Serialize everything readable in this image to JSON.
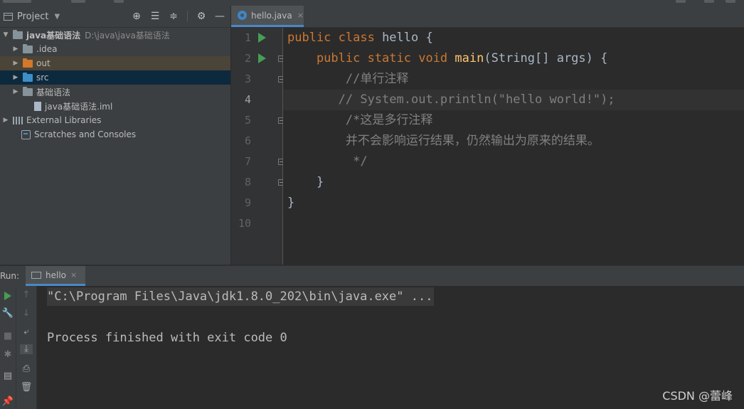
{
  "project_panel": {
    "title": "Project",
    "tree": [
      {
        "label": "java基础语法",
        "path": "D:\\java\\java基础语法",
        "kind": "module",
        "level": 0
      },
      {
        "label": ".idea",
        "kind": "folder-grey",
        "level": 1
      },
      {
        "label": "out",
        "kind": "folder-orange",
        "level": 1
      },
      {
        "label": "src",
        "kind": "folder-blue",
        "level": 1
      },
      {
        "label": "基础语法",
        "kind": "folder-grey",
        "level": 1
      },
      {
        "label": "java基础语法.iml",
        "kind": "file",
        "level": 1
      },
      {
        "label": "External Libraries",
        "kind": "libraries",
        "level": 0
      },
      {
        "label": "Scratches and Consoles",
        "kind": "scratches",
        "level": 0
      }
    ]
  },
  "editor": {
    "tab": {
      "label": "hello.java",
      "close": "×"
    },
    "current_line": 4,
    "lines": [
      {
        "num": "1",
        "segments": [
          {
            "t": "public class ",
            "c": "kw"
          },
          {
            "t": "hello ",
            "c": "pl"
          },
          {
            "t": "{",
            "c": "pl"
          }
        ]
      },
      {
        "num": "2",
        "segments": [
          {
            "t": "    public static void ",
            "c": "kw"
          },
          {
            "t": "main",
            "c": "fn"
          },
          {
            "t": "(String[] args) {",
            "c": "pl"
          }
        ]
      },
      {
        "num": "3",
        "segments": [
          {
            "t": "        //单行注释",
            "c": "cm"
          }
        ]
      },
      {
        "num": "4",
        "segments": [
          {
            "t": "       // System.out.println(\"hello world!\");",
            "c": "cm"
          }
        ]
      },
      {
        "num": "5",
        "segments": [
          {
            "t": "        /*这是多行注释",
            "c": "cm"
          }
        ]
      },
      {
        "num": "6",
        "segments": [
          {
            "t": "        并不会影响运行结果，仍然输出为原来的结果。",
            "c": "cm"
          }
        ]
      },
      {
        "num": "7",
        "segments": [
          {
            "t": "         */",
            "c": "cm"
          }
        ]
      },
      {
        "num": "8",
        "segments": [
          {
            "t": "    }",
            "c": "pl"
          }
        ]
      },
      {
        "num": "9",
        "segments": [
          {
            "t": "}",
            "c": "pl"
          }
        ]
      },
      {
        "num": "10",
        "segments": []
      }
    ]
  },
  "run_panel": {
    "label": "Run:",
    "tab": {
      "label": "hello",
      "close": "×"
    },
    "output": [
      "\"C:\\Program Files\\Java\\jdk1.8.0_202\\bin\\java.exe\" ...",
      "",
      "Process finished with exit code 0"
    ]
  },
  "watermark": "CSDN @蕾峰",
  "colors": {
    "keyword": "#cc7832",
    "method": "#ffc66d",
    "comment": "#808080",
    "plain": "#a9b7c6",
    "accent": "#4a88c7",
    "run_green": "#499c54"
  }
}
